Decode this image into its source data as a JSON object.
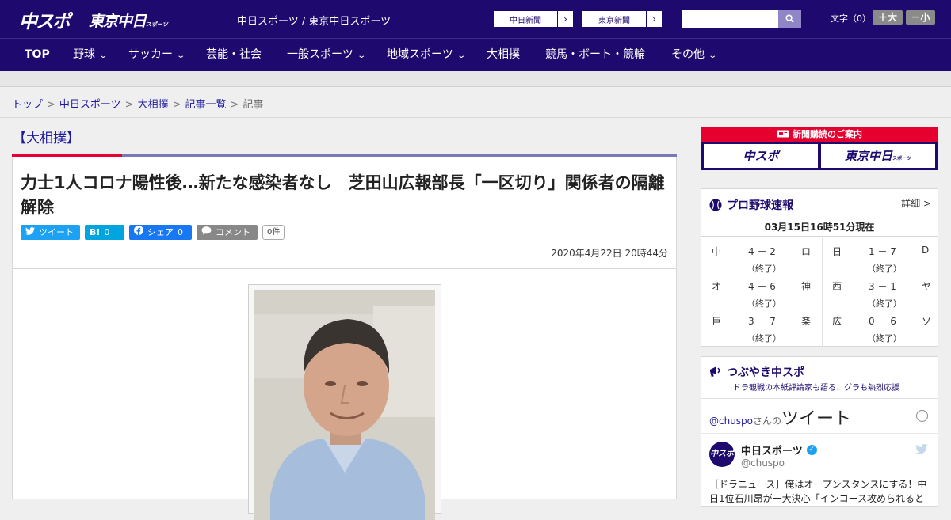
{
  "header": {
    "logo_chu": "中スポ",
    "logo_tokyo": "東京中日",
    "logo_tokyo_sub": "スポーツ",
    "site_title": "中日スポーツ / 東京中日スポーツ",
    "ext_links": [
      "中日新聞",
      "東京新聞"
    ],
    "search_placeholder": "",
    "font_size_label": "文字（0）",
    "font_plus": "＋大",
    "font_minus": "－小"
  },
  "nav": {
    "items": [
      {
        "label": "TOP",
        "dropdown": false
      },
      {
        "label": "野球",
        "dropdown": true
      },
      {
        "label": "サッカー",
        "dropdown": true
      },
      {
        "label": "芸能・社会",
        "dropdown": false
      },
      {
        "label": "一般スポーツ",
        "dropdown": true
      },
      {
        "label": "地域スポーツ",
        "dropdown": true
      },
      {
        "label": "大相撲",
        "dropdown": false
      },
      {
        "label": "競馬・ボート・競輪",
        "dropdown": false
      },
      {
        "label": "その他",
        "dropdown": true
      }
    ]
  },
  "breadcrumb": {
    "items": [
      "トップ",
      "中日スポーツ",
      "大相撲",
      "記事一覧"
    ],
    "current": "記事",
    "separator": ">"
  },
  "article": {
    "category": "【大相撲】",
    "headline": "力士1人コロナ陽性後…新たな感染者なし　芝田山広報部長「一区切り」関係者の隔離解除",
    "share": {
      "tweet": "ツイート",
      "hatena_icon": "B!",
      "hatena_count": "0",
      "facebook": "シェア",
      "facebook_count": "0",
      "comment": "コメント",
      "comment_count": "0件"
    },
    "date": "2020年4月22日 20時44分"
  },
  "sidebar": {
    "promo_title": "新聞購読のご案内",
    "promo_cards": [
      "中スポ",
      "東京中日"
    ],
    "promo_card_sub": "スポーツ",
    "baseball": {
      "title": "プロ野球速報",
      "detail": "詳細 >",
      "timestamp": "03月15日16時51分現在",
      "games": [
        {
          "team1": "中",
          "score": "4 － 2",
          "team2": "ロ",
          "status": "（終了）"
        },
        {
          "team1": "日",
          "score": "1 － 7",
          "team2": "D",
          "status": "（終了）"
        },
        {
          "team1": "オ",
          "score": "4 － 6",
          "team2": "神",
          "status": "（終了）"
        },
        {
          "team1": "西",
          "score": "3 － 1",
          "team2": "ヤ",
          "status": "（終了）"
        },
        {
          "team1": "巨",
          "score": "3 － 7",
          "team2": "楽",
          "status": "（終了）"
        },
        {
          "team1": "広",
          "score": "0 － 6",
          "team2": "ソ",
          "status": "（終了）"
        }
      ]
    },
    "twitter": {
      "title": "つぶやき中スポ",
      "subtitle": "ドラ観戦の本紙評論家も語る、グラも熱烈応援",
      "handle_link": "@chuspo",
      "handle_suffix": "さんの",
      "header_big": "ツイート",
      "account_name": "中日スポーツ",
      "account_handle": "@chuspo",
      "avatar_text": "中スポ",
      "tweet_text": "［ドラニュース］俺はオープンスタンスにする！中日1位石川昂が一大決心「インコース攻められると"
    }
  },
  "colors": {
    "brand_navy": "#1e0a6e",
    "accent_red": "#e60030",
    "twitter_blue": "#1da1f2",
    "hatena_blue": "#00a4de",
    "facebook_blue": "#1877f2",
    "comment_gray": "#888888"
  }
}
